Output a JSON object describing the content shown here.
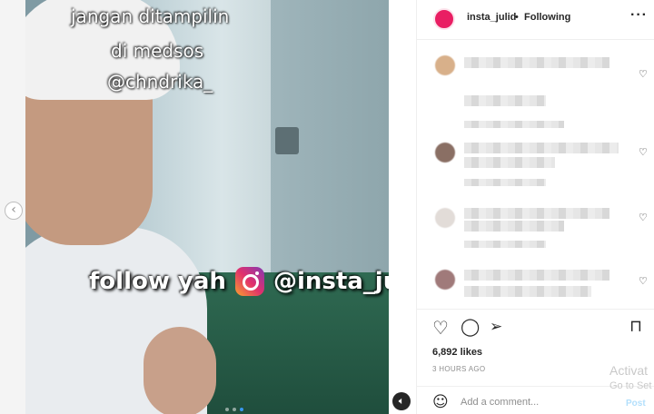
{
  "post": {
    "overlay_line1": "jangan ditampilin",
    "overlay_line2": "di medsos",
    "overlay_line3": "@chndrika_",
    "follow_text": "follow yah",
    "follow_handle": "@insta_julid",
    "carousel_dots": 3,
    "active_dot": 1,
    "prev_icon": "chevron-left-icon",
    "mute_icon": "speaker-icon"
  },
  "header": {
    "username": "insta_julid",
    "separator": "•",
    "follow_status": "Following",
    "more_icon": "more-horizontal-icon"
  },
  "actions": {
    "like_icon": "heart-icon",
    "comment_icon": "comment-icon",
    "share_icon": "share-icon",
    "save_icon": "bookmark-icon"
  },
  "stats": {
    "likes": "6,892 likes",
    "time": "3 HOURS AGO"
  },
  "composer": {
    "placeholder": "Add a comment...",
    "post_label": "Post",
    "emoji_icon": "smiley-icon"
  },
  "os_watermark": {
    "line1": "Activat",
    "line2": "Go to Set"
  },
  "colors": {
    "accent_blue": "#3897f0",
    "post_disabled": "#b2dffc",
    "border": "#efefef"
  }
}
